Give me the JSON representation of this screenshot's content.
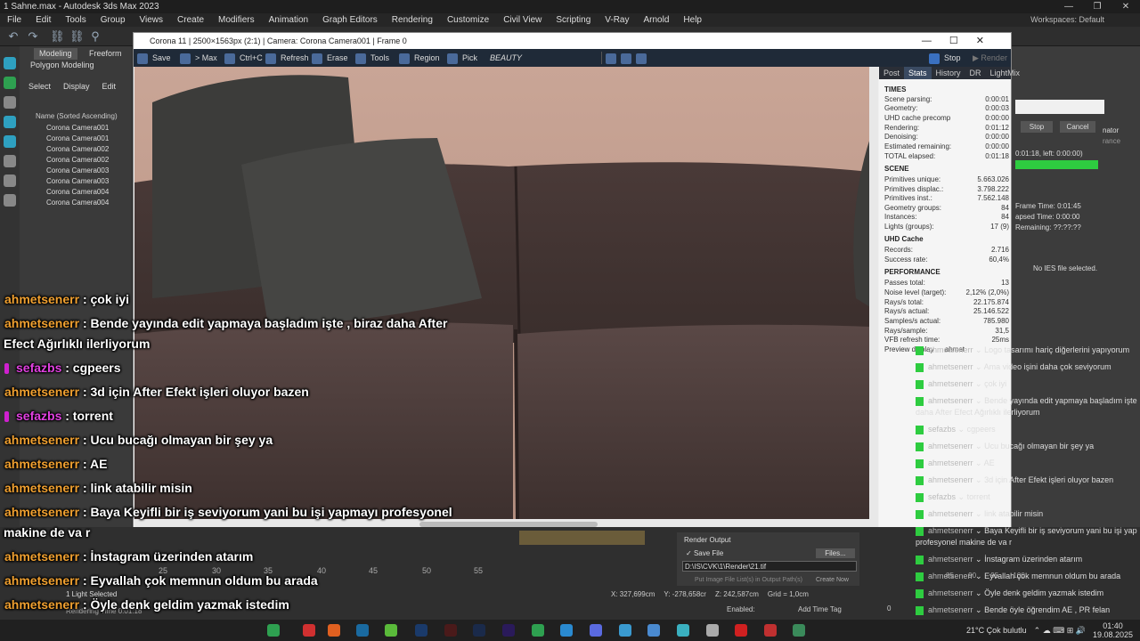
{
  "app": {
    "title": "1 Sahne.max - Autodesk 3ds Max 2023",
    "workspace": "Workspaces: Default"
  },
  "menu": [
    "File",
    "Edit",
    "Tools",
    "Group",
    "Views",
    "Create",
    "Modifiers",
    "Animation",
    "Graph Editors",
    "Rendering",
    "Customize",
    "Civil View",
    "Scripting",
    "V-Ray",
    "Arnold",
    "Help"
  ],
  "ribbon": {
    "modeling": "Modeling",
    "freeform": "Freeform",
    "polygon": "Polygon Modeling"
  },
  "scene_explorer": {
    "tabs": [
      "Select",
      "Display",
      "Edit"
    ],
    "header": "Name (Sorted Ascending)",
    "rows": [
      "Corona Camera001",
      "Corona Camera001",
      "Corona Camera002",
      "Corona Camera002",
      "Corona Camera003",
      "Corona Camera003",
      "Corona Camera004",
      "Corona Camera004"
    ]
  },
  "vfb": {
    "title": "Corona 11 | 2500×1563px (2:1) | Camera: Corona Camera001 | Frame 0",
    "toolbar": {
      "save": "Save",
      "tomax": "> Max",
      "ctrlc": "Ctrl+C",
      "refresh": "Refresh",
      "erase": "Erase",
      "tools": "Tools",
      "region": "Region",
      "pick": "Pick",
      "channel": "BEAUTY",
      "stop": "Stop",
      "render": "Render"
    },
    "tabs": [
      "Post",
      "Stats",
      "History",
      "DR",
      "LightMix"
    ],
    "stats": {
      "times_h": "TIMES",
      "times": [
        [
          "Scene parsing:",
          "0:00:01"
        ],
        [
          "Geometry:",
          "0:00:03"
        ],
        [
          "UHD cache precomp",
          "0:00:00"
        ],
        [
          "Rendering:",
          "0:01:12"
        ],
        [
          "Denoising:",
          "0:00:00"
        ],
        [
          "Estimated remaining:",
          "0:00:00"
        ],
        [
          "TOTAL elapsed:",
          "0:01:18"
        ]
      ],
      "scene_h": "SCENE",
      "scene": [
        [
          "Primitives unique:",
          "5.663.026"
        ],
        [
          "Primitives displac.:",
          "3.798.222"
        ],
        [
          "Primitives inst.:",
          "7.562.148"
        ],
        [
          "Geometry groups:",
          "84"
        ],
        [
          "Instances:",
          "84"
        ],
        [
          "Lights (groups):",
          "17 (9)"
        ]
      ],
      "uhd_h": "UHD Cache",
      "uhd": [
        [
          "Records:",
          "2.716"
        ],
        [
          "Success rate:",
          "60,4%"
        ]
      ],
      "perf_h": "PERFORMANCE",
      "perf": [
        [
          "Passes total:",
          "13"
        ],
        [
          "Noise level (target):",
          "2,12% (2,0%)"
        ],
        [
          "Rays/s total:",
          "22.175.874"
        ],
        [
          "Rays/s actual:",
          "25.146.522"
        ],
        [
          "Samples/s actual:",
          "785.980"
        ],
        [
          "Rays/sample:",
          "31,5"
        ],
        [
          "VFB refresh time:",
          "25ms"
        ],
        [
          "Preview display",
          "ahmet"
        ]
      ]
    }
  },
  "render_progress": {
    "stop": "Stop",
    "cancel": "Cancel",
    "elapsed": "0:01:18, left: 0:00:00)",
    "frame_time": "Frame Time: 0:01:45",
    "elapsed_time": "apsed Time: 0:00:00",
    "remaining": "Remaining: ??:??:??",
    "ies": "No IES file selected.",
    "sidelabel": "nator",
    "sidelabel2": "rance"
  },
  "render_output": {
    "label": "Render Output",
    "save_file": "Save File",
    "files": "Files...",
    "path": "D:\\IS\\CVK\\1\\Render\\21.tif",
    "put": "Put Image File List(s) in Output Path(s)",
    "create": "Create Now"
  },
  "timeline_ticks": [
    "25",
    "30",
    "35",
    "40",
    "45",
    "50",
    "55"
  ],
  "right_ticks": [
    "85",
    "90",
    "95",
    "100"
  ],
  "status": {
    "selection": "1 Light Selected",
    "rendering": "Rendering Time 0:01:18",
    "x": "X: 327,699cm",
    "y": "Y: -278,658cr",
    "z": "Z: 242,587cm",
    "grid": "Grid = 1,0cm",
    "enabled": "Enabled:",
    "addtag": "Add Time Tag",
    "frame": "0"
  },
  "chat_overlay": [
    {
      "user": "ahmetsenerr",
      "msg": ": çok iyi"
    },
    {
      "user": "ahmetsenerr",
      "msg": ": Bende yayında edit yapmaya başladım işte , biraz daha After"
    },
    {
      "user": "",
      "msg": "Efect Ağırlıklı ilerliyorum"
    },
    {
      "user": "sefazbs",
      "msg": ": cgpeers"
    },
    {
      "user": "ahmetsenerr",
      "msg": ": 3d için After Efekt işleri oluyor bazen"
    },
    {
      "user": "sefazbs",
      "msg": ": torrent"
    },
    {
      "user": "ahmetsenerr",
      "msg": ": Ucu bucağı olmayan bir şey ya"
    },
    {
      "user": "ahmetsenerr",
      "msg": ": AE"
    },
    {
      "user": "ahmetsenerr",
      "msg": ": link atabilir misin"
    },
    {
      "user": "ahmetsenerr",
      "msg": ": Baya Keyifli bir iş seviyorum yani bu işi yapmayı profesyonel"
    },
    {
      "user": "",
      "msg": "makine de va r"
    },
    {
      "user": "ahmetsenerr",
      "msg": ": İnstagram üzerinden atarım"
    },
    {
      "user": "ahmetsenerr",
      "msg": ": Eyvallah çok memnun oldum bu arada"
    },
    {
      "user": "ahmetsenerr",
      "msg": ": Öyle denk geldim yazmak istedim"
    },
    {
      "user": "ahmetsenerr",
      "msg": ": Bende öyle öğrendim AE , PR felan"
    }
  ],
  "chat_side": [
    {
      "user": "ahmetsenerr",
      "msg": "Logo tasarımı hariç diğerlerini yapıyorum"
    },
    {
      "user": "ahmetsenerr",
      "msg": "Ama video işini daha çok seviyorum"
    },
    {
      "user": "ahmetsenerr",
      "msg": "çok iyi"
    },
    {
      "user": "ahmetsenerr",
      "msg": "Bende yayında edit yapmaya başladım işte"
    },
    {
      "user": "",
      "msg": "daha After Efect Ağırlıklı ilerliyorum"
    },
    {
      "user": "sefazbs",
      "msg": "cgpeers"
    },
    {
      "user": "ahmetsenerr",
      "msg": "Ucu bucağı olmayan bir şey ya"
    },
    {
      "user": "ahmetsenerr",
      "msg": "AE"
    },
    {
      "user": "ahmetsenerr",
      "msg": "3d için After Efekt işleri oluyor bazen"
    },
    {
      "user": "sefazbs",
      "msg": "torrent"
    },
    {
      "user": "ahmetsenerr",
      "msg": "link atabilir misin"
    },
    {
      "user": "ahmetsenerr",
      "msg": "Baya Keyifli bir iş seviyorum yani bu işi yap"
    },
    {
      "user": "",
      "msg": "profesyonel makine de va r"
    },
    {
      "user": "ahmetsenerr",
      "msg": "İnstagram üzerinden atarım"
    },
    {
      "user": "ahmetsenerr",
      "msg": "Eyvallah çok memnun oldum bu arada"
    },
    {
      "user": "ahmetsenerr",
      "msg": "Öyle denk geldim yazmak istedim"
    },
    {
      "user": "ahmetsenerr",
      "msg": "Bende öyle öğrendim AE , PR felan"
    }
  ],
  "taskbar": {
    "weather": "21°C  Çok bulutlu",
    "time": "01:40",
    "date": "19.08.2025"
  },
  "colors": {
    "accent": "#f0a030",
    "green": "#2ecc40",
    "magenta": "#d020d0"
  }
}
